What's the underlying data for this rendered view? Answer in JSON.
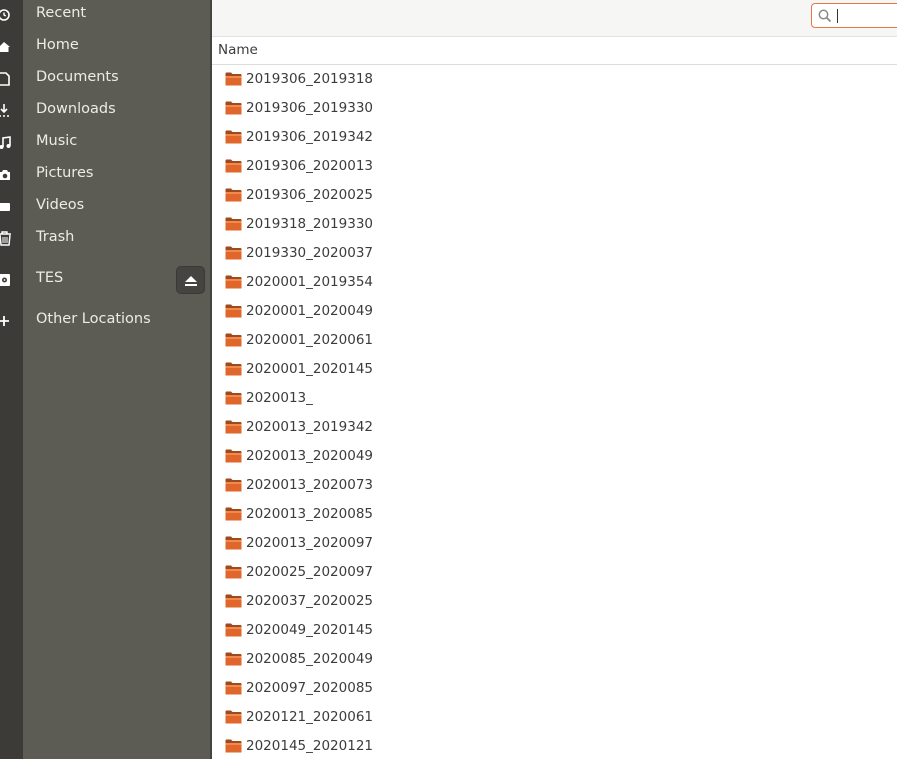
{
  "sidebar": {
    "items": [
      {
        "label": "Recent",
        "icon": "clock-icon"
      },
      {
        "label": "Home",
        "icon": "home-icon"
      },
      {
        "label": "Documents",
        "icon": "document-icon"
      },
      {
        "label": "Downloads",
        "icon": "download-icon"
      },
      {
        "label": "Music",
        "icon": "music-icon"
      },
      {
        "label": "Pictures",
        "icon": "camera-icon"
      },
      {
        "label": "Videos",
        "icon": "video-icon"
      },
      {
        "label": "Trash",
        "icon": "trash-icon"
      },
      {
        "label": "TES",
        "icon": "drive-icon"
      },
      {
        "label": "Other Locations",
        "icon": "plus-icon"
      }
    ]
  },
  "search": {
    "value": "",
    "icon": "search-icon"
  },
  "columns": {
    "name": "Name"
  },
  "files": [
    "2019306_2019318",
    "2019306_2019330",
    "2019306_2019342",
    "2019306_2020013",
    "2019306_2020025",
    "2019318_2019330",
    "2019330_2020037",
    "2020001_2019354",
    "2020001_2020049",
    "2020001_2020061",
    "2020001_2020145",
    "2020013_",
    "2020013_2019342",
    "2020013_2020049",
    "2020013_2020073",
    "2020013_2020085",
    "2020013_2020097",
    "2020025_2020097",
    "2020037_2020025",
    "2020049_2020145",
    "2020085_2020049",
    "2020097_2020085",
    "2020121_2020061",
    "2020145_2020121"
  ],
  "colors": {
    "sidebar_bg": "#5d5c54",
    "dock_bg": "#3c3b37",
    "folder_orange": "#e0662b",
    "search_border": "#e5774a"
  }
}
